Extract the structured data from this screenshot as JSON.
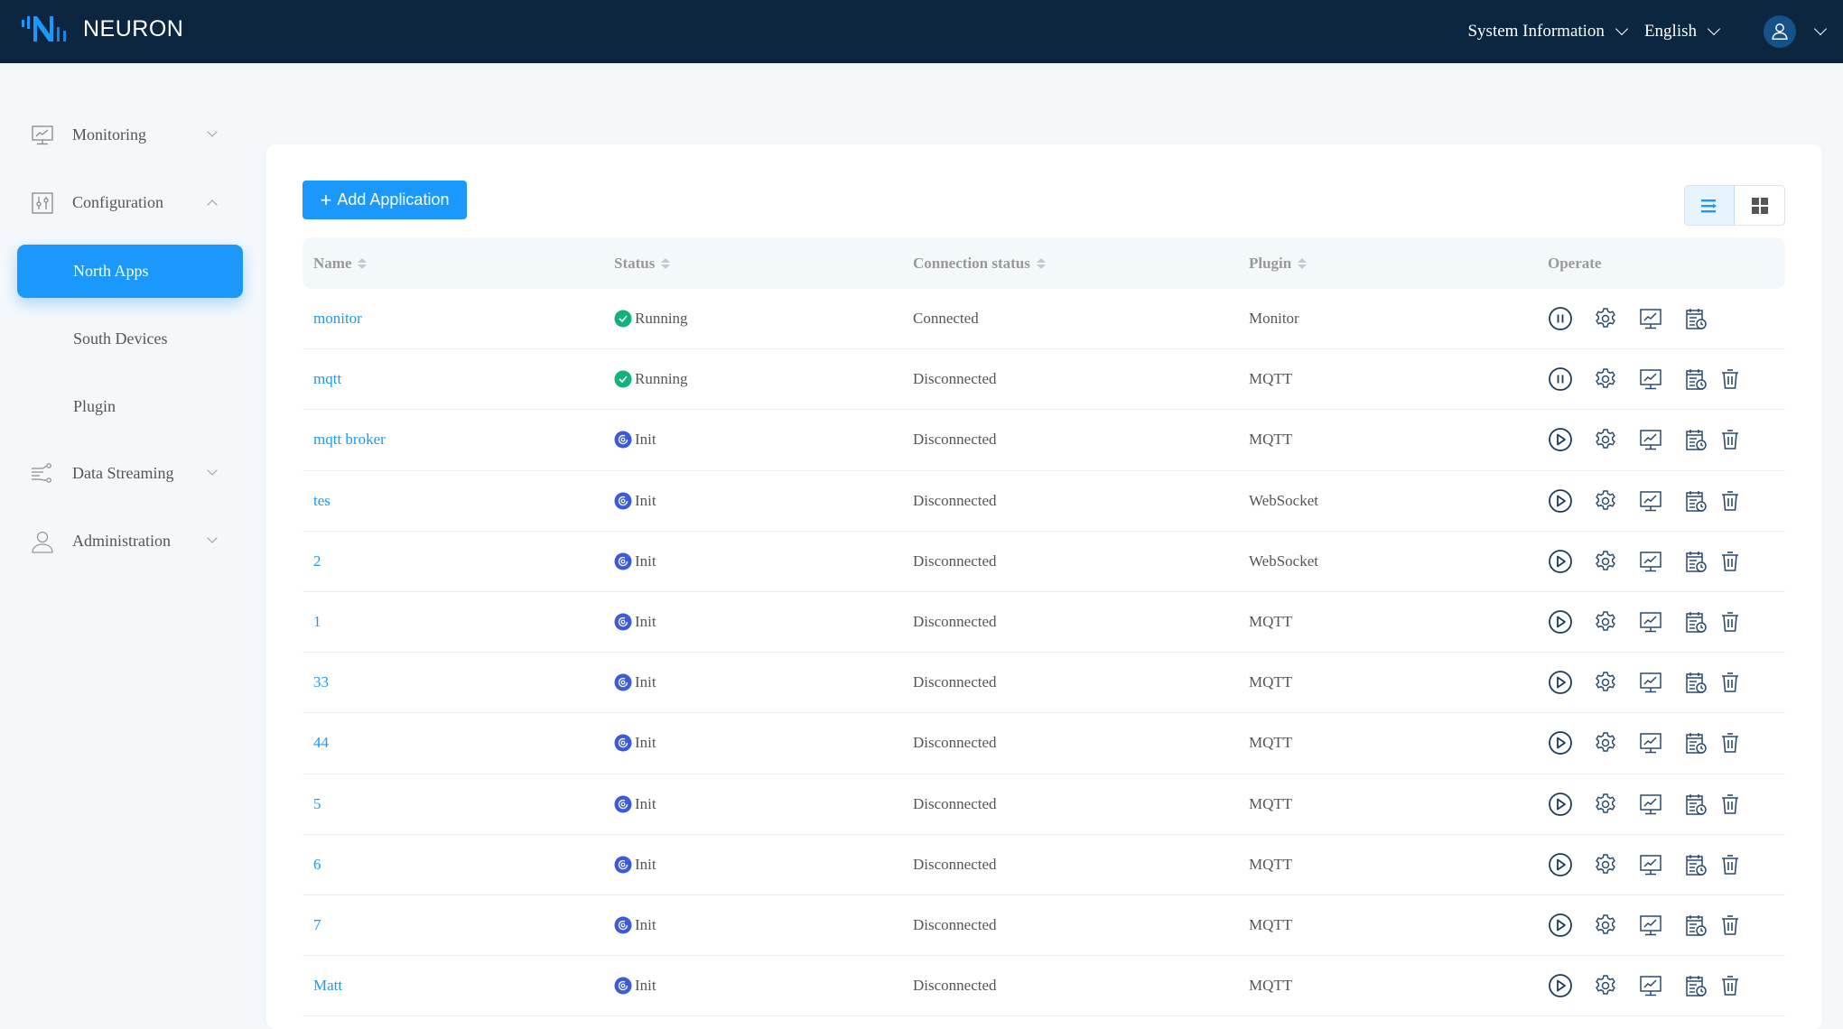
{
  "header": {
    "brand": "NEURON",
    "system_info_label": "System Information",
    "language_label": "English",
    "colors": {
      "bar": "#0d2640",
      "logo": "#1a98fc",
      "avatar": "#15528a"
    }
  },
  "sidebar": {
    "items": [
      {
        "label": "Monitoring",
        "icon": "monitor-chart-icon",
        "expanded": false
      },
      {
        "label": "Configuration",
        "icon": "sliders-icon",
        "expanded": true
      },
      {
        "label": "North Apps",
        "active": true
      },
      {
        "label": "South Devices"
      },
      {
        "label": "Plugin"
      },
      {
        "label": "Data Streaming",
        "icon": "data-stream-icon",
        "expanded": false
      },
      {
        "label": "Administration",
        "icon": "user-icon",
        "expanded": false
      }
    ]
  },
  "toolbar": {
    "add_label": "Add Application",
    "view_modes": [
      "list",
      "card"
    ],
    "active_view": "list"
  },
  "table": {
    "columns": [
      "Name",
      "Status",
      "Connection status",
      "Plugin",
      "Operate"
    ],
    "rows": [
      {
        "name": "monitor",
        "status": "Running",
        "connection": "Connected",
        "plugin": "Monitor",
        "running": true,
        "deletable": false
      },
      {
        "name": "mqtt",
        "status": "Running",
        "connection": "Disconnected",
        "plugin": "MQTT",
        "running": true,
        "deletable": true
      },
      {
        "name": "mqtt broker",
        "status": "Init",
        "connection": "Disconnected",
        "plugin": "MQTT",
        "running": false,
        "deletable": true
      },
      {
        "name": "tes",
        "status": "Init",
        "connection": "Disconnected",
        "plugin": "WebSocket",
        "running": false,
        "deletable": true
      },
      {
        "name": "2",
        "status": "Init",
        "connection": "Disconnected",
        "plugin": "WebSocket",
        "running": false,
        "deletable": true
      },
      {
        "name": "1",
        "status": "Init",
        "connection": "Disconnected",
        "plugin": "MQTT",
        "running": false,
        "deletable": true
      },
      {
        "name": "33",
        "status": "Init",
        "connection": "Disconnected",
        "plugin": "MQTT",
        "running": false,
        "deletable": true
      },
      {
        "name": "44",
        "status": "Init",
        "connection": "Disconnected",
        "plugin": "MQTT",
        "running": false,
        "deletable": true
      },
      {
        "name": "5",
        "status": "Init",
        "connection": "Disconnected",
        "plugin": "MQTT",
        "running": false,
        "deletable": true
      },
      {
        "name": "6",
        "status": "Init",
        "connection": "Disconnected",
        "plugin": "MQTT",
        "running": false,
        "deletable": true
      },
      {
        "name": "7",
        "status": "Init",
        "connection": "Disconnected",
        "plugin": "MQTT",
        "running": false,
        "deletable": true
      },
      {
        "name": "Matt",
        "status": "Init",
        "connection": "Disconnected",
        "plugin": "MQTT",
        "running": false,
        "deletable": true
      }
    ],
    "status_colors": {
      "Running": "#13b27b",
      "Init": "#3b5bdb"
    }
  }
}
